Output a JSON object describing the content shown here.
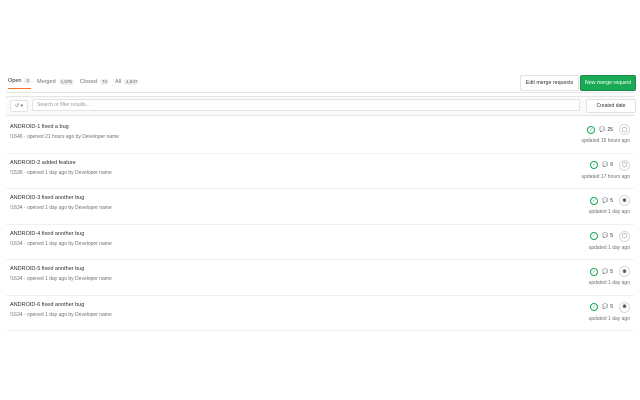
{
  "tabs": [
    {
      "label": "Open",
      "count": "3",
      "active": true
    },
    {
      "label": "Merged",
      "count": "1,576",
      "active": false
    },
    {
      "label": "Closed",
      "count": "74",
      "active": false
    },
    {
      "label": "All",
      "count": "1,647",
      "active": false
    }
  ],
  "buttons": {
    "edit": "Edit merge requests",
    "new": "New merge request"
  },
  "filter": {
    "history_icon": "↺ ▾",
    "search_placeholder": "Search or filter results...",
    "sort": "Created date"
  },
  "merge_requests": [
    {
      "title": "ANDROID-1 fixed a bug",
      "meta": "!1646 · opened 21 hours ago by Developer name",
      "comments": "25",
      "updated": "updated 15 hours ago",
      "avatar": "◯"
    },
    {
      "title": "ANDROID-2 added feature",
      "meta": "!1536 · opened 1 day ago by Developer name",
      "comments": "6",
      "updated": "updated 17 hours ago",
      "avatar": "◯"
    },
    {
      "title": "ANDROID-3 fixed another bug",
      "meta": "!1634 · opened 1 day ago by Developer name",
      "comments": "5",
      "updated": "updated 1 day ago",
      "avatar": "⚉"
    },
    {
      "title": "ANDROID-4 fixed another bug",
      "meta": "!1634 · opened 1 day ago by Developer name",
      "comments": "5",
      "updated": "updated 1 day ago",
      "avatar": "◯"
    },
    {
      "title": "ANDROID-5 fixed another bug",
      "meta": "!1634 · opened 1 day ago by Developer name",
      "comments": "5",
      "updated": "updated 1 day ago",
      "avatar": "⚉"
    },
    {
      "title": "ANDROID-6 fixed another bug",
      "meta": "!1634 · opened 1 day ago by Developer name",
      "comments": "5",
      "updated": "updated 1 day ago",
      "avatar": "⚉"
    }
  ],
  "colors": {
    "accent": "#1aaa55",
    "tab_active": "#fc6d26"
  }
}
